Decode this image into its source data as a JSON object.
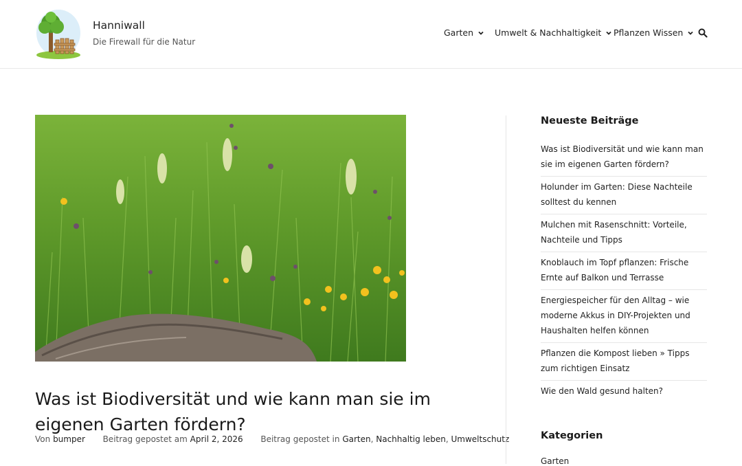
{
  "header": {
    "site_title": "Hanniwall",
    "site_description": "Die Firewall für die Natur",
    "logo_icon": "tree-fence-logo",
    "nav": [
      {
        "label": "Garten",
        "icon": "chevron-down-icon"
      },
      {
        "label": "Umwelt & Nachhaltigkeit",
        "icon": "chevron-down-icon"
      },
      {
        "label": "Pflanzen Wissen",
        "icon": "chevron-down-icon"
      }
    ],
    "search_icon": "search-icon"
  },
  "post": {
    "image_alt": "Wildblumenwiese mit Totholz",
    "title": "Was ist Biodiversität und wie kann man sie im eigenen Garten fördern?",
    "meta": {
      "author_prefix": "Von",
      "author": "bumper",
      "date_prefix": "Beitrag gepostet am",
      "date": "April 2, 2026",
      "category_prefix": "Beitrag gepostet in",
      "categories": [
        "Garten",
        "Nachhaltig leben",
        "Umweltschutz"
      ]
    }
  },
  "sidebar": {
    "recent_title": "Neueste Beiträge",
    "recent_posts": [
      "Was ist Biodiversität und wie kann man sie im eigenen Garten fördern?",
      "Holunder im Garten: Diese Nachteile solltest du kennen",
      "Mulchen mit Rasenschnitt: Vorteile, Nachteile und Tipps",
      "Knoblauch im Topf pflanzen: Frische Ernte auf Balkon und Terrasse",
      "Energiespeicher für den Alltag – wie moderne Akkus in DIY-Projekten und Haushalten helfen können",
      "Pflanzen die Kompost lieben » Tipps zum richtigen Einsatz",
      "Wie den Wald gesund halten?"
    ],
    "categories_title": "Kategorien",
    "categories": [
      "Garten"
    ]
  },
  "colors": {
    "text": "#222222",
    "muted": "#555555",
    "border": "#e6e6e6"
  }
}
